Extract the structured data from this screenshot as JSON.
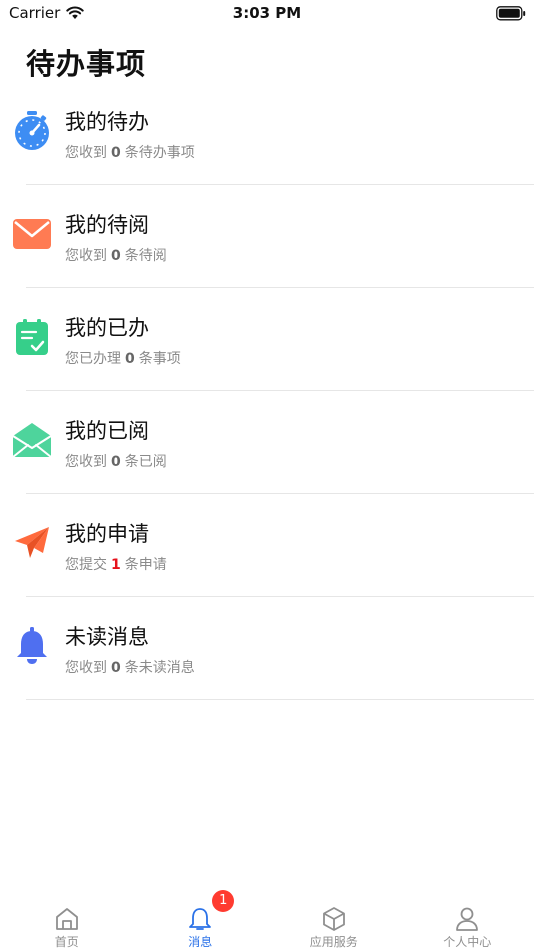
{
  "status_bar": {
    "carrier": "Carrier",
    "time": "3:03 PM"
  },
  "page": {
    "title": "待办事项"
  },
  "tasks": [
    {
      "title": "我的待办",
      "desc_prefix": "您收到",
      "count": "0",
      "desc_suffix": "条待办事项",
      "icon": "stopwatch-icon",
      "color": "#3d8df3"
    },
    {
      "title": "我的待阅",
      "desc_prefix": "您收到",
      "count": "0",
      "desc_suffix": "条待阅",
      "icon": "envelope-icon",
      "color": "#ff7b53"
    },
    {
      "title": "我的已办",
      "desc_prefix": "您已办理",
      "count": "0",
      "desc_suffix": "条事项",
      "icon": "clipboard-check-icon",
      "color": "#36cf8a"
    },
    {
      "title": "我的已阅",
      "desc_prefix": "您收到",
      "count": "0",
      "desc_suffix": "条已阅",
      "icon": "open-envelope-icon",
      "color": "#4ed49c"
    },
    {
      "title": "我的申请",
      "desc_prefix": "您提交",
      "count": "1",
      "desc_suffix": "条申请",
      "icon": "paper-plane-icon",
      "color": "#ff6a3d",
      "count_color": "#e6111b"
    },
    {
      "title": "未读消息",
      "desc_prefix": "您收到",
      "count": "0",
      "desc_suffix": "条未读消息",
      "icon": "bell-icon",
      "color": "#4f6ff0"
    }
  ],
  "tab_bar": {
    "tabs": [
      {
        "label": "首页",
        "icon": "home-icon",
        "active": false
      },
      {
        "label": "消息",
        "icon": "bell-icon",
        "active": true,
        "badge": "1"
      },
      {
        "label": "应用服务",
        "icon": "box-icon",
        "active": false
      },
      {
        "label": "个人中心",
        "icon": "person-icon",
        "active": false
      }
    ],
    "active_color": "#2b72e8",
    "inactive_color": "#8f8f8f",
    "badge_color": "#ff3b30"
  }
}
